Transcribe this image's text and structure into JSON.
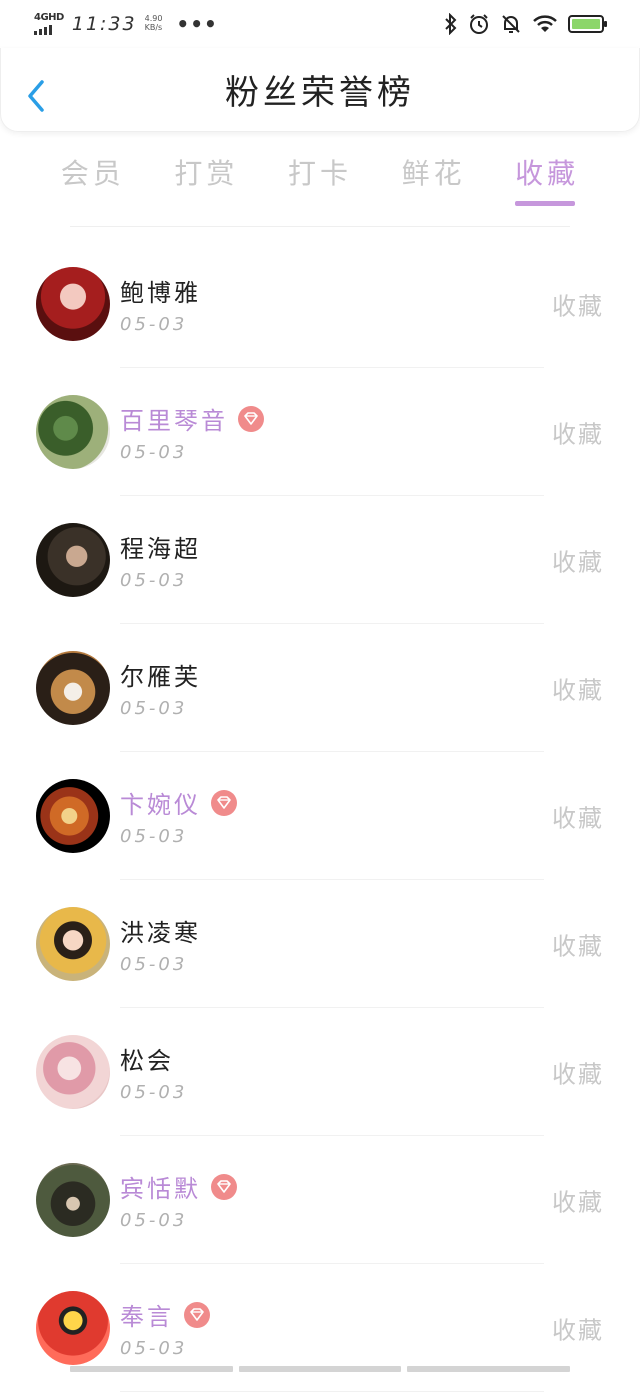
{
  "status_bar": {
    "network": "4GHD",
    "time": "11:33",
    "speed_value": "4.90",
    "speed_unit": "KB/s",
    "more": "•••"
  },
  "header": {
    "title": "粉丝荣誉榜"
  },
  "tabs": [
    {
      "label": "会员",
      "active": false
    },
    {
      "label": "打赏",
      "active": false
    },
    {
      "label": "打卡",
      "active": false
    },
    {
      "label": "鲜花",
      "active": false
    },
    {
      "label": "收藏",
      "active": true
    }
  ],
  "fans": [
    {
      "name": "鲍博雅",
      "date": "05-03",
      "action": "收藏",
      "vip": false
    },
    {
      "name": "百里琴音",
      "date": "05-03",
      "action": "收藏",
      "vip": true
    },
    {
      "name": "程海超",
      "date": "05-03",
      "action": "收藏",
      "vip": false
    },
    {
      "name": "尔雁芙",
      "date": "05-03",
      "action": "收藏",
      "vip": false
    },
    {
      "name": "卞婉仪",
      "date": "05-03",
      "action": "收藏",
      "vip": true
    },
    {
      "name": "洪凌寒",
      "date": "05-03",
      "action": "收藏",
      "vip": false
    },
    {
      "name": "松会",
      "date": "05-03",
      "action": "收藏",
      "vip": false
    },
    {
      "name": "宾恬默",
      "date": "05-03",
      "action": "收藏",
      "vip": true
    },
    {
      "name": "奉言",
      "date": "05-03",
      "action": "收藏",
      "vip": true
    }
  ],
  "colors": {
    "accent": "#c697dc",
    "vip_name": "#b98ad6",
    "gem_badge": "#f08b8b",
    "muted": "#c8c8c8",
    "back_arrow": "#2a9ee6"
  },
  "icons": [
    "back-arrow-icon",
    "bluetooth-icon",
    "alarm-icon",
    "mute-bell-icon",
    "wifi-icon",
    "battery-icon",
    "diamond-icon"
  ]
}
